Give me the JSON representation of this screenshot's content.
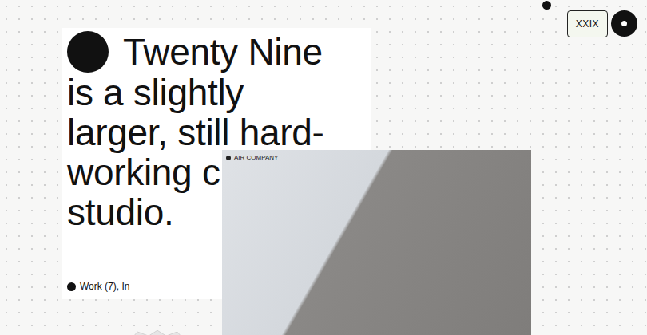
{
  "header": {
    "badge": "XXIX"
  },
  "intro": {
    "heading_lines": [
      "Twenty Nine",
      "is a slightly",
      "larger, still hard-",
      "working c",
      "studio."
    ],
    "nav": "Work (7), In"
  },
  "feature": {
    "caption": "AIR COMPANY"
  }
}
